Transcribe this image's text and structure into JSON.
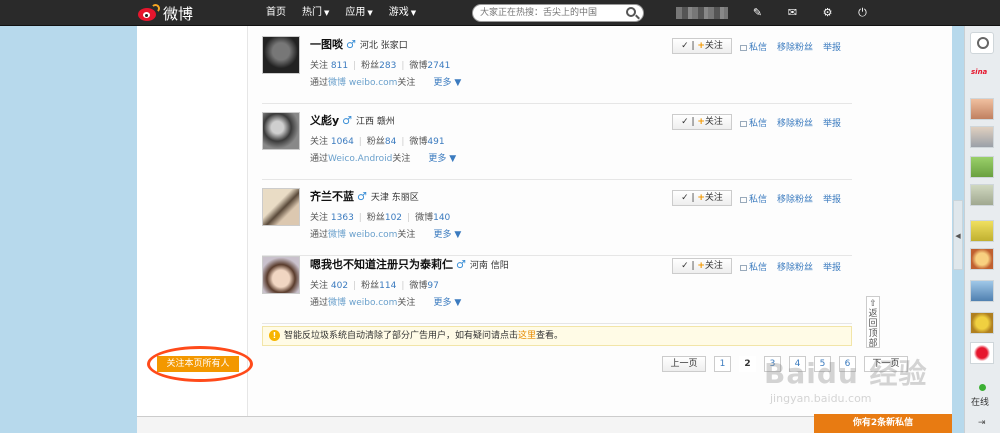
{
  "topbar": {
    "logo_text": "微博",
    "nav": [
      {
        "label": "首页",
        "dropdown": false
      },
      {
        "label": "热门",
        "dropdown": true
      },
      {
        "label": "应用",
        "dropdown": true
      },
      {
        "label": "游戏",
        "dropdown": true
      }
    ],
    "search_placeholder": "大家正在热搜：舌尖上的中国",
    "icons": [
      "edit-icon",
      "mail-icon",
      "gear-icon",
      "power-icon"
    ]
  },
  "users": [
    {
      "name": "一图啖",
      "gender": "♂",
      "location": "河北 张家口",
      "follow_label": "关注",
      "following_label": "关注",
      "following": "811",
      "fans_label": "粉丝",
      "fans": "283",
      "weibo_label": "微博",
      "weibo": "2741",
      "via_prefix": "通过",
      "via": "微博 weibo.com",
      "via_suffix": "关注",
      "more": "更多"
    },
    {
      "name": "义彪y",
      "gender": "♂",
      "location": "江西 赣州",
      "follow_label": "关注",
      "following_label": "关注",
      "following": "1064",
      "fans_label": "粉丝",
      "fans": "84",
      "weibo_label": "微博",
      "weibo": "491",
      "via_prefix": "通过",
      "via": "Weico.Android",
      "via_suffix": "关注",
      "more": "更多"
    },
    {
      "name": "齐兰不蓝",
      "gender": "♂",
      "location": "天津 东丽区",
      "follow_label": "关注",
      "following_label": "关注",
      "following": "1363",
      "fans_label": "粉丝",
      "fans": "102",
      "weibo_label": "微博",
      "weibo": "140",
      "via_prefix": "通过",
      "via": "微博 weibo.com",
      "via_suffix": "关注",
      "more": "更多"
    },
    {
      "name": "嗯我也不知道注册只为泰莉仁",
      "gender": "♂",
      "location": "河南 信阳",
      "follow_label": "关注",
      "following_label": "关注",
      "following": "402",
      "fans_label": "粉丝",
      "fans": "114",
      "weibo_label": "微博",
      "weibo": "97",
      "via_prefix": "通过",
      "via": "微博 weibo.com",
      "via_suffix": "关注",
      "more": "更多"
    }
  ],
  "row_actions": {
    "message": "私信",
    "remove_fan": "移除粉丝",
    "report": "举报"
  },
  "notice": {
    "text": "智能反垃圾系统自动清除了部分广告用户，如有疑问请点击",
    "link": "这里",
    "suffix": "查看。"
  },
  "follow_all_label": "关注本页所有人",
  "pager": {
    "prev": "上一页",
    "pages": [
      "1",
      "2",
      "3",
      "4",
      "5",
      "6"
    ],
    "current": "2",
    "next": "下一页"
  },
  "back_top_label": "返回顶部",
  "sidebar": {
    "online_label": "在线"
  },
  "message_bar": "你有2条新私信",
  "watermark": {
    "brand": "Baidu 经验",
    "url": "jingyan.baidu.com"
  }
}
